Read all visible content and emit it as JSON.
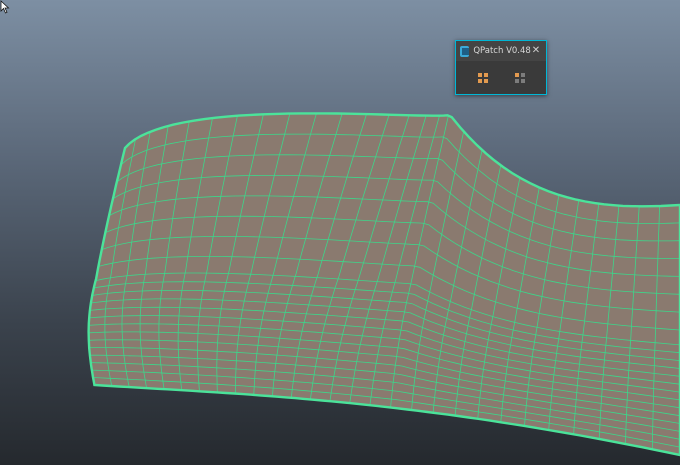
{
  "viewport": {
    "background_top": "#7d8fa3",
    "background_bottom": "#25292e",
    "mesh_fill": "#8a7a6f",
    "wire_color": "#3dd68a",
    "selection_border": "#4be39a"
  },
  "qpatch_window": {
    "title": "QPatch V0.48",
    "icon": "app-icon",
    "close_icon": "close-icon",
    "close_glyph": "✕",
    "accent": "#00b7d6",
    "tools": [
      {
        "name": "patch-grid-tool",
        "icon": "grid-icon",
        "color": "#e39a4f"
      },
      {
        "name": "patch-quad-tool",
        "icon": "grid-icon",
        "color": "#e39a4f"
      }
    ]
  }
}
